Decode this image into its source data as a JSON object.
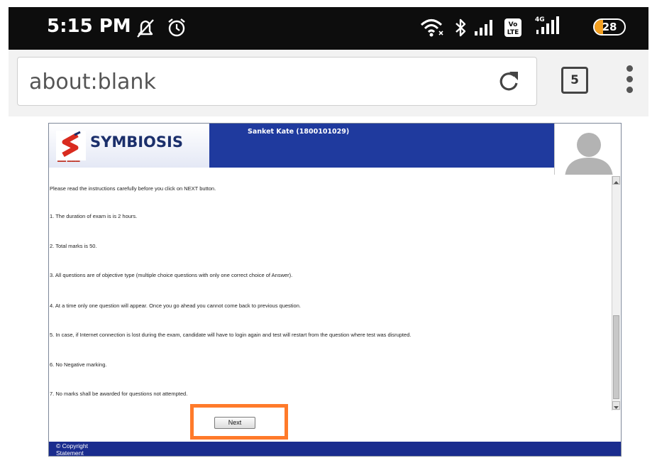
{
  "status_bar": {
    "time": "5:15 PM",
    "icons": [
      "mute-icon",
      "alarm-clock-icon",
      "wifi-icon",
      "bluetooth-icon",
      "signal-icon",
      "volte-icon",
      "4g-signal-icon"
    ],
    "battery": "28",
    "battery_level_percent": 28,
    "battery_color": "#f4a020"
  },
  "browser": {
    "url": "about:blank",
    "tab_count": "5",
    "icons": [
      "reload-icon",
      "menu-dots-icon"
    ]
  },
  "exam_page": {
    "brand": "SYMBIOSIS",
    "candidate": "Sanket Kate (1800101029)",
    "header_color": "#1f3a9e",
    "instructions": [
      "Please read the instructions carefully before you click on NEXT button.",
      "1. The duration of exam is is 2 hours.",
      "2. Total marks is 50.",
      "3. All questions are of objective type (multiple choice questions with only one correct choice of Answer).",
      "4. At a time only one question will appear. Once you go ahead you cannot come back to previous question.",
      "5. In case, if Internet connection is lost during the exam, candidate will have to login again and test will restart from the question where test was disrupted.",
      "6. No Negative marking.",
      "7. No marks shall be awarded for questions not attempted."
    ],
    "next_label": "Next",
    "highlight_color": "#ff7a2a",
    "footer": "© Copyright Statement"
  }
}
